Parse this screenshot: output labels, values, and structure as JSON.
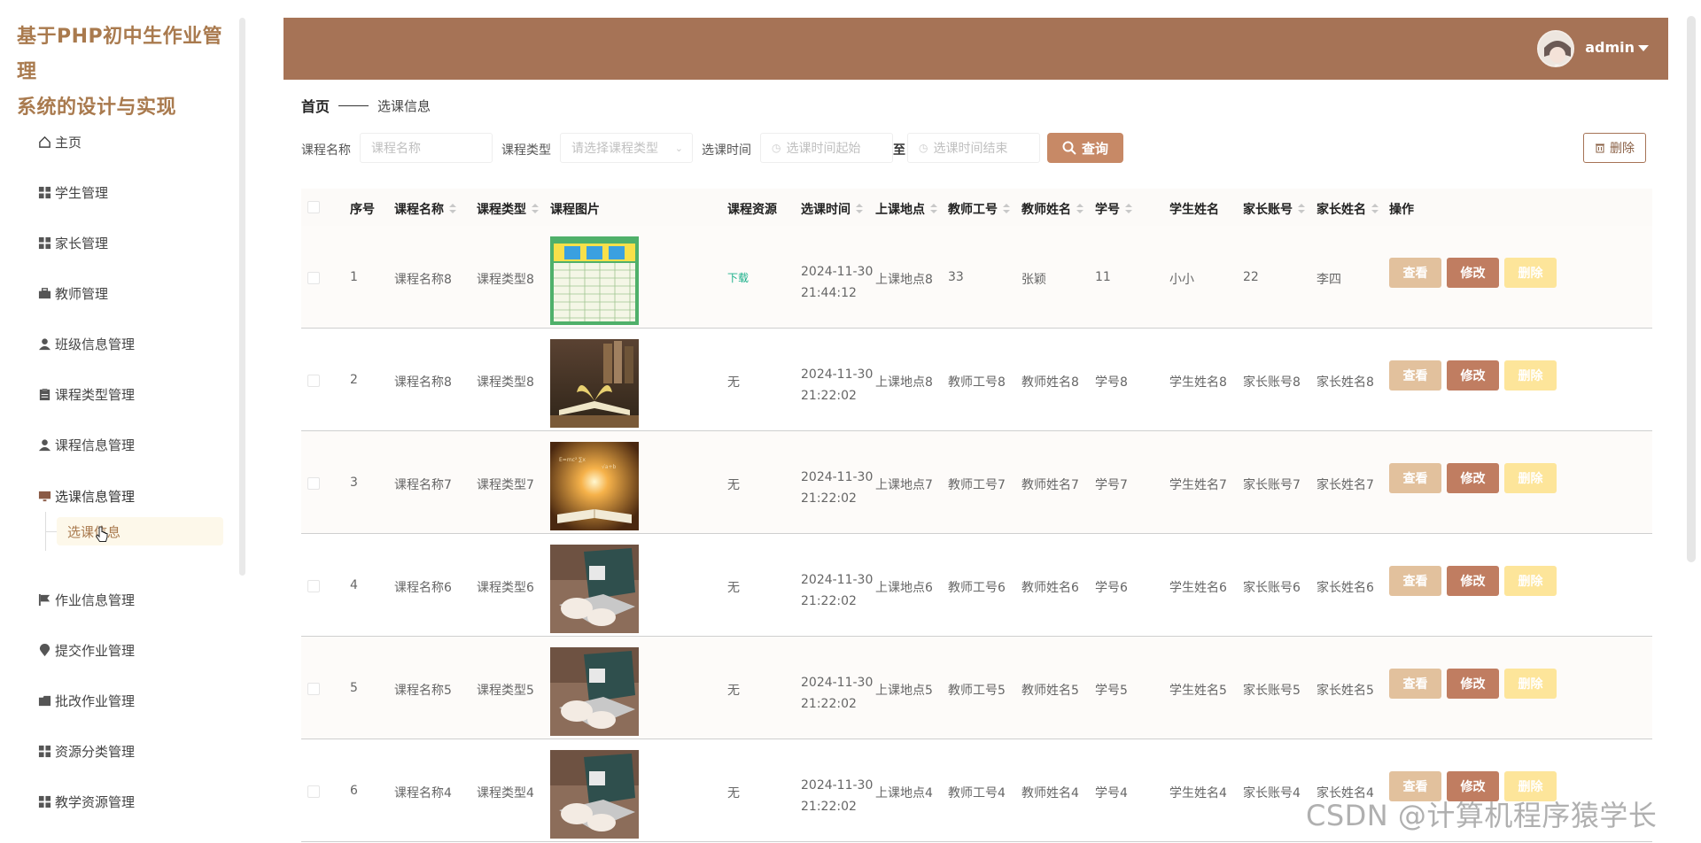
{
  "brand": {
    "line1": "基于PHP初中生作业管理",
    "line2": "系统的设计与实现"
  },
  "menu": [
    {
      "label": "主页",
      "icon": "home-icon"
    },
    {
      "label": "学生管理",
      "icon": "grid-icon"
    },
    {
      "label": "家长管理",
      "icon": "grid-icon"
    },
    {
      "label": "教师管理",
      "icon": "briefcase-icon"
    },
    {
      "label": "班级信息管理",
      "icon": "user-icon"
    },
    {
      "label": "课程类型管理",
      "icon": "clipboard-icon"
    },
    {
      "label": "课程信息管理",
      "icon": "user-icon"
    },
    {
      "label": "选课信息管理",
      "icon": "monitor-icon"
    },
    {
      "label": "作业信息管理",
      "icon": "flag-icon"
    },
    {
      "label": "提交作业管理",
      "icon": "location-icon"
    },
    {
      "label": "批改作业管理",
      "icon": "folder-icon"
    },
    {
      "label": "资源分类管理",
      "icon": "grid-icon"
    },
    {
      "label": "教学资源管理",
      "icon": "grid-icon"
    }
  ],
  "submenu": {
    "label": "选课信息"
  },
  "header": {
    "username": "admin"
  },
  "breadcrumb": {
    "home": "首页",
    "current": "选课信息"
  },
  "search": {
    "course_name_label": "课程名称",
    "course_name_placeholder": "课程名称",
    "course_type_label": "课程类型",
    "course_type_placeholder": "请选择课程类型",
    "time_label": "选课时间",
    "time_start_placeholder": "选课时间起始",
    "to_label": "至",
    "time_end_placeholder": "选课时间结束",
    "query_label": "查询",
    "delete_label": "删除"
  },
  "table": {
    "columns": [
      "序号",
      "课程名称",
      "课程类型",
      "课程图片",
      "课程资源",
      "选课时间",
      "上课地点",
      "教师工号",
      "教师姓名",
      "学号",
      "学生姓名",
      "家长账号",
      "家长姓名",
      "操作"
    ],
    "actions": {
      "view": "查看",
      "edit": "修改",
      "delete": "删除"
    },
    "rows": [
      {
        "no": "1",
        "course_name": "课程名称8",
        "course_type": "课程类型8",
        "resource": "下载",
        "time_date": "2024-11-30",
        "time_clock": "21:44:12",
        "location": "上课地点8",
        "teacher_id": "33",
        "teacher_name": "张颖",
        "student_id": "11",
        "student_name": "小小",
        "parent_account": "22",
        "parent_name": "李四",
        "image": "schedule"
      },
      {
        "no": "2",
        "course_name": "课程名称8",
        "course_type": "课程类型8",
        "resource": "无",
        "time_date": "2024-11-30",
        "time_clock": "21:22:02",
        "location": "上课地点8",
        "teacher_id": "教师工号8",
        "teacher_name": "教师姓名8",
        "student_id": "学号8",
        "student_name": "学生姓名8",
        "parent_account": "家长账号8",
        "parent_name": "家长姓名8",
        "image": "book"
      },
      {
        "no": "3",
        "course_name": "课程名称7",
        "course_type": "课程类型7",
        "resource": "无",
        "time_date": "2024-11-30",
        "time_clock": "21:22:02",
        "location": "上课地点7",
        "teacher_id": "教师工号7",
        "teacher_name": "教师姓名7",
        "student_id": "学号7",
        "student_name": "学生姓名7",
        "parent_account": "家长账号7",
        "parent_name": "家长姓名7",
        "image": "glow"
      },
      {
        "no": "4",
        "course_name": "课程名称6",
        "course_type": "课程类型6",
        "resource": "无",
        "time_date": "2024-11-30",
        "time_clock": "21:22:02",
        "location": "上课地点6",
        "teacher_id": "教师工号6",
        "teacher_name": "教师姓名6",
        "student_id": "学号6",
        "student_name": "学生姓名6",
        "parent_account": "家长账号6",
        "parent_name": "家长姓名6",
        "image": "laptop"
      },
      {
        "no": "5",
        "course_name": "课程名称5",
        "course_type": "课程类型5",
        "resource": "无",
        "time_date": "2024-11-30",
        "time_clock": "21:22:02",
        "location": "上课地点5",
        "teacher_id": "教师工号5",
        "teacher_name": "教师姓名5",
        "student_id": "学号5",
        "student_name": "学生姓名5",
        "parent_account": "家长账号5",
        "parent_name": "家长姓名5",
        "image": "laptop"
      },
      {
        "no": "6",
        "course_name": "课程名称4",
        "course_type": "课程类型4",
        "resource": "无",
        "time_date": "2024-11-30",
        "time_clock": "21:22:02",
        "location": "上课地点4",
        "teacher_id": "教师工号4",
        "teacher_name": "教师姓名4",
        "student_id": "学号4",
        "student_name": "学生姓名4",
        "parent_account": "家长账号4",
        "parent_name": "家长姓名4",
        "image": "laptop"
      }
    ]
  },
  "watermark": "CSDN @计算机程序猿学长",
  "colors": {
    "header": "#a67356",
    "brand": "#a97a4e",
    "view": "#e2c19d",
    "edit": "#c07d61",
    "delete": "#fde59a",
    "download": "#1bb08a"
  }
}
